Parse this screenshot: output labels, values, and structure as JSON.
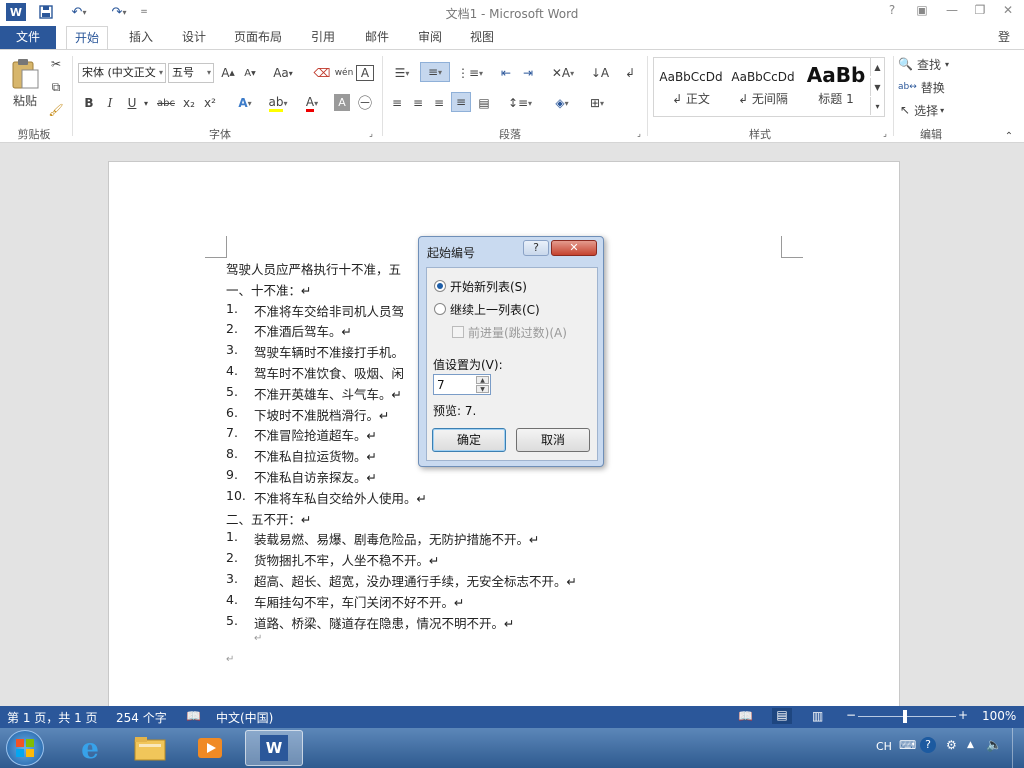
{
  "window": {
    "title": "文档1 - Microsoft Word",
    "login": "登录",
    "help": "?"
  },
  "tabs": [
    "文件",
    "开始",
    "插入",
    "设计",
    "页面布局",
    "引用",
    "邮件",
    "审阅",
    "视图"
  ],
  "ribbon": {
    "clipboard": {
      "paste": "粘贴",
      "label": "剪贴板"
    },
    "font": {
      "name": "宋体 (中文正文",
      "size": "五号",
      "aa": "Aa",
      "wen": "wén",
      "label": "字体",
      "bold": "B",
      "italic": "I",
      "underline": "U",
      "strike": "abc",
      "sub": "x₂",
      "sup": "x²"
    },
    "paragraph": {
      "label": "段落"
    },
    "styles": {
      "label": "样式",
      "items": [
        {
          "preview": "AaBbCcDd",
          "name": "↲ 正文"
        },
        {
          "preview": "AaBbCcDd",
          "name": "↲ 无间隔"
        },
        {
          "preview": "AaBb",
          "name": "标题 1"
        }
      ]
    },
    "editing": {
      "find": "查找",
      "replace": "替换",
      "select": "选择",
      "label": "编辑"
    }
  },
  "document": {
    "lines": [
      "驾驶人员应严格执行十不准，五",
      "一、十不准：↵",
      "不准将车交给非司机人员驾",
      "不准酒后驾车。↵",
      "驾驶车辆时不准接打手机。",
      "驾车时不准饮食、吸烟、闲",
      "不准开英雄车、斗气车。↵",
      "下坡时不准脱档滑行。↵",
      "不准冒险抢道超车。↵",
      "不准私自拉运货物。↵",
      "不准私自访亲探友。↵",
      "不准将车私自交给外人使用。↵",
      "二、五不开：↵",
      "装载易燃、易爆、剧毒危险品，无防护措施不开。↵",
      "货物捆扎不牢，人坐不稳不开。↵",
      "超高、超长、超宽，没办理通行手续，无安全标志不开。↵",
      "车厢挂勾不牢，车门关闭不好不开。↵",
      "道路、桥梁、隧道存在隐患，情况不明不开。↵",
      "↵",
      "↵"
    ],
    "numbers": [
      "",
      "",
      "1.",
      "2.",
      "3.",
      "4.",
      "5.",
      "6.",
      "7.",
      "8.",
      "9.",
      "10.",
      "",
      "1.",
      "2.",
      "3.",
      "4.",
      "5.",
      "",
      ""
    ]
  },
  "dialog": {
    "title": "起始编号",
    "help": "?",
    "close": "✕",
    "opt_new": "开始新列表(S)",
    "opt_continue": "继续上一列表(C)",
    "opt_advance": "前进量(跳过数)(A)",
    "value_label": "值设置为(V):",
    "value": "7",
    "preview": "预览: 7.",
    "ok": "确定",
    "cancel": "取消"
  },
  "status": {
    "page": "第 1 页，共 1 页",
    "words": "254 个字",
    "lang": "中文(中国)",
    "zoom": "100%"
  },
  "tray": {
    "ime": "CH"
  },
  "colors": {
    "accent": "#2b579a"
  }
}
